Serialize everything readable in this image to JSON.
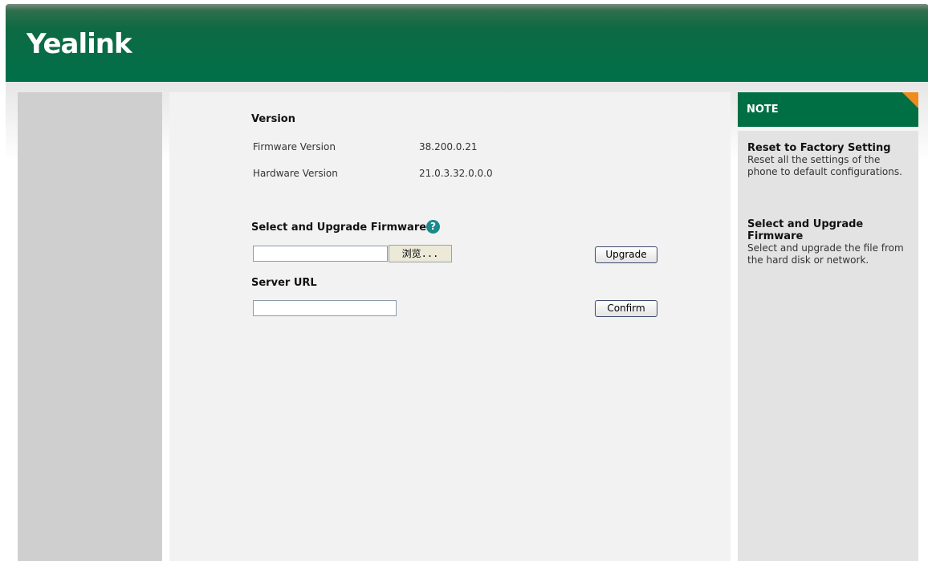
{
  "header": {
    "logo_text": "Yealink",
    "brand_color": "#00704a"
  },
  "version": {
    "title": "Version",
    "rows": [
      {
        "label": "Firmware Version",
        "value": "38.200.0.21"
      },
      {
        "label": "Hardware Version",
        "value": "21.0.3.32.0.0.0"
      }
    ]
  },
  "upgrade": {
    "title": "Select and Upgrade Firmware",
    "help_icon": "question-circle-icon",
    "file_value": "",
    "browse_label": "浏览...",
    "upgrade_label": "Upgrade"
  },
  "server": {
    "title": "Server URL",
    "url_value": "",
    "confirm_label": "Confirm"
  },
  "note": {
    "title": "NOTE",
    "accent_color": "#f08a1c",
    "items": [
      {
        "heading": "Reset to Factory Setting",
        "body": "Reset all the settings of the phone to default configurations."
      },
      {
        "heading": "Select and Upgrade Firmware",
        "body": "Select and upgrade the file from the hard disk or network."
      }
    ]
  }
}
